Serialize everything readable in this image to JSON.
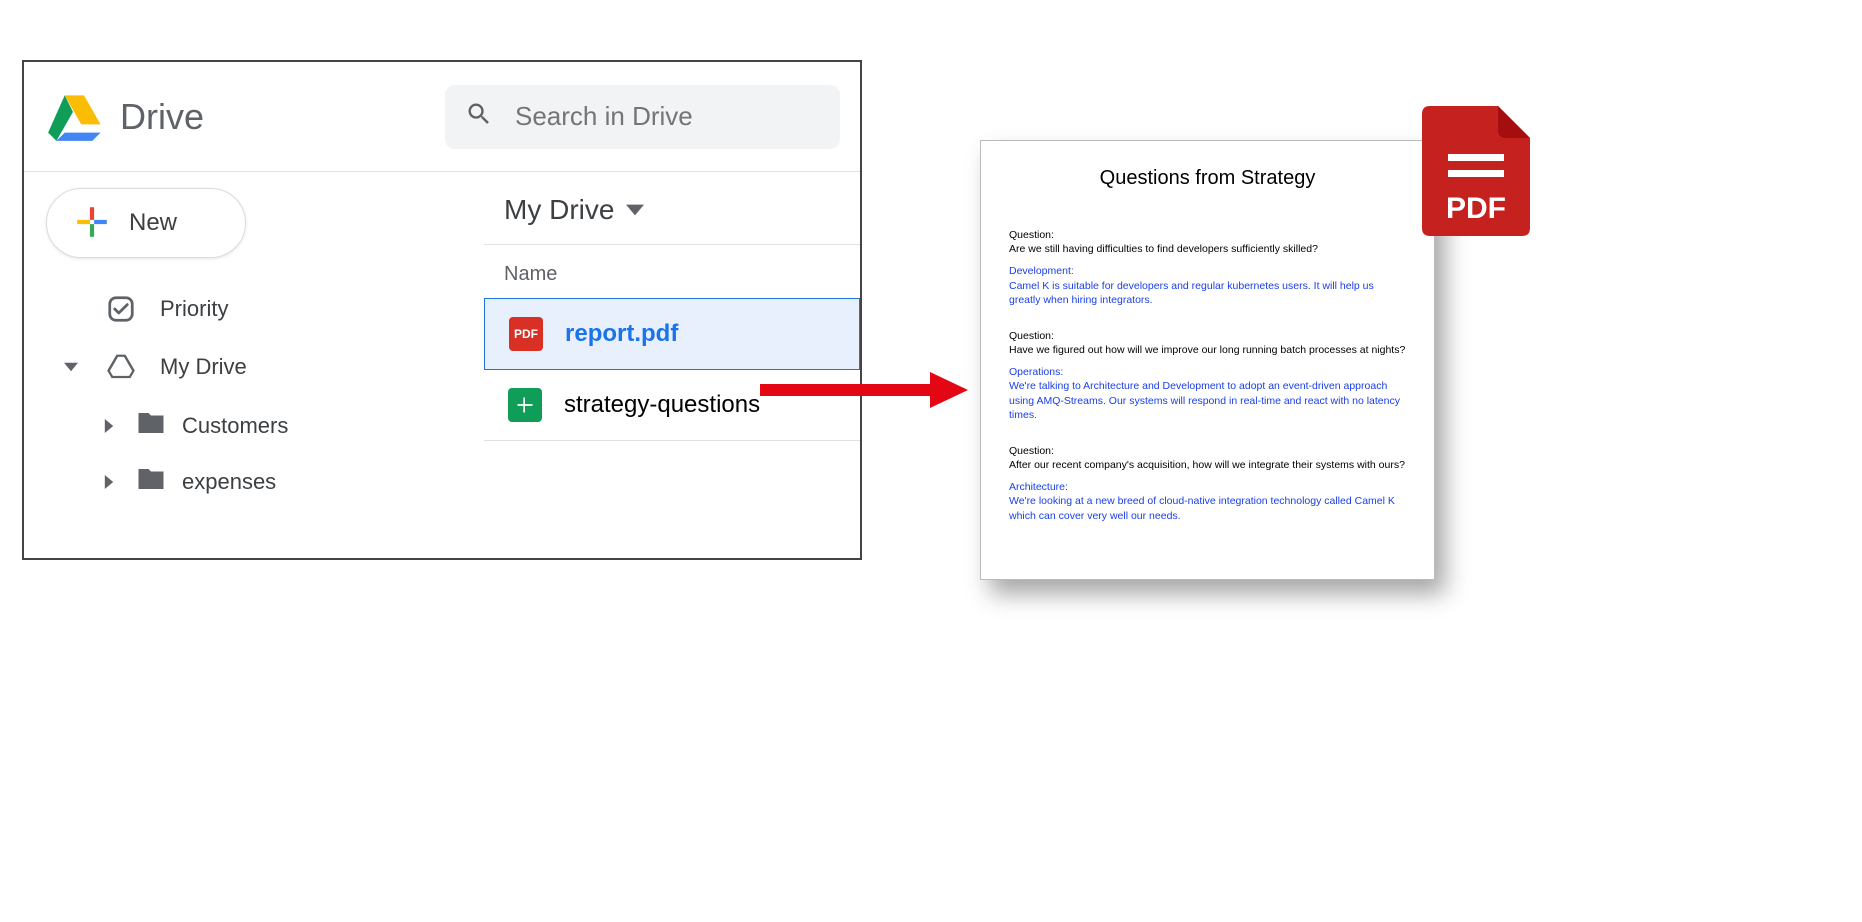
{
  "drive": {
    "app_name": "Drive",
    "search_placeholder": "Search in Drive",
    "new_button": "New",
    "sidebar": {
      "priority": "Priority",
      "my_drive": "My Drive",
      "folders": [
        {
          "name": "Customers"
        },
        {
          "name": "expenses"
        }
      ]
    },
    "breadcrumb": "My Drive",
    "column_header": "Name",
    "files": [
      {
        "name": "report.pdf",
        "type": "pdf",
        "selected": true
      },
      {
        "name": "strategy-questions",
        "type": "sheet",
        "selected": false
      }
    ]
  },
  "pdf_badge_label": "PDF",
  "pdf_preview": {
    "title": "Questions from Strategy",
    "items": [
      {
        "q_label": "Question:",
        "q_text": "Are we still having difficulties to find developers sufficiently skilled?",
        "a_label": "Development:",
        "a_text": "Camel K is suitable for developers and regular kubernetes users. It will help us greatly when hiring integrators."
      },
      {
        "q_label": "Question:",
        "q_text": "Have we figured out how will we improve our long running batch processes at nights?",
        "a_label": "Operations:",
        "a_text": "We're talking to Architecture and Development to adopt an event-driven approach using AMQ-Streams. Our systems will respond in real-time and react with no latency times."
      },
      {
        "q_label": "Question:",
        "q_text": "After our recent company's acquisition, how will we integrate their systems with ours?",
        "a_label": "Architecture:",
        "a_text": "We're looking at a new breed of cloud-native integration technology called Camel K which can cover very well our needs."
      }
    ]
  }
}
